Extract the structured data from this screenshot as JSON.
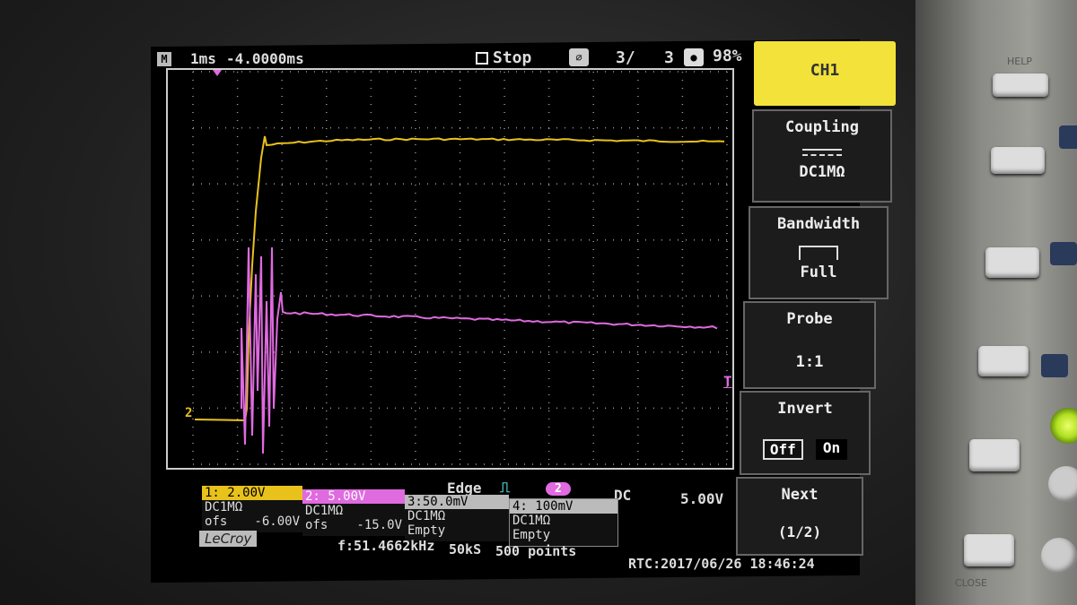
{
  "topbar": {
    "mode_icon": "M",
    "timebase": "1ms",
    "delay": "-4.0000ms",
    "run_state": "Stop",
    "acq_count": "3/",
    "acq_total": "3",
    "memory": "98%"
  },
  "trigger": {
    "type": "Edge",
    "slope_icon": "rising-edge-icon",
    "source": "2",
    "coupling": "DC",
    "level": "5.00V",
    "marker_left": "2",
    "marker_right": "T"
  },
  "channels": [
    {
      "label": "1: 2.00V",
      "coupling": "DC1MΩ",
      "ofs_label": "ofs",
      "offset": "-6.00V",
      "color": "#e8c21a"
    },
    {
      "label": "2: 5.00V",
      "coupling": "DC1MΩ",
      "ofs_label": "ofs",
      "offset": "-15.0V",
      "color": "#e06ae0"
    },
    {
      "label": "3:50.0mV",
      "coupling": "DC1MΩ",
      "ofs_label": "Empty",
      "offset": "",
      "color": "#cccccc"
    },
    {
      "label": "4: 100mV",
      "coupling": "DC1MΩ",
      "ofs_label": "Empty",
      "offset": "",
      "color": "#cccccc"
    }
  ],
  "footer": {
    "brand": "LeCroy",
    "frequency": "f:51.4662kHz",
    "sample_rate": "50kS",
    "points": "500 points",
    "rtc": "RTC:2017/06/26  18:46:24"
  },
  "menu": {
    "header": "CH1",
    "coupling_title": "Coupling",
    "coupling_value": "DC1MΩ",
    "bandwidth_title": "Bandwidth",
    "bandwidth_value": "Full",
    "probe_title": "Probe",
    "probe_value": "1:1",
    "invert_title": "Invert",
    "invert_off": "Off",
    "invert_on": "On",
    "next_title": "Next",
    "next_value": "(1/2)"
  },
  "hardware": {
    "help_label": "HELP",
    "close_label": "CLOSE"
  },
  "colors": {
    "ch1": "#e8c21a",
    "ch2": "#e06ae0",
    "menu_header_bg": "#f2e23a"
  }
}
